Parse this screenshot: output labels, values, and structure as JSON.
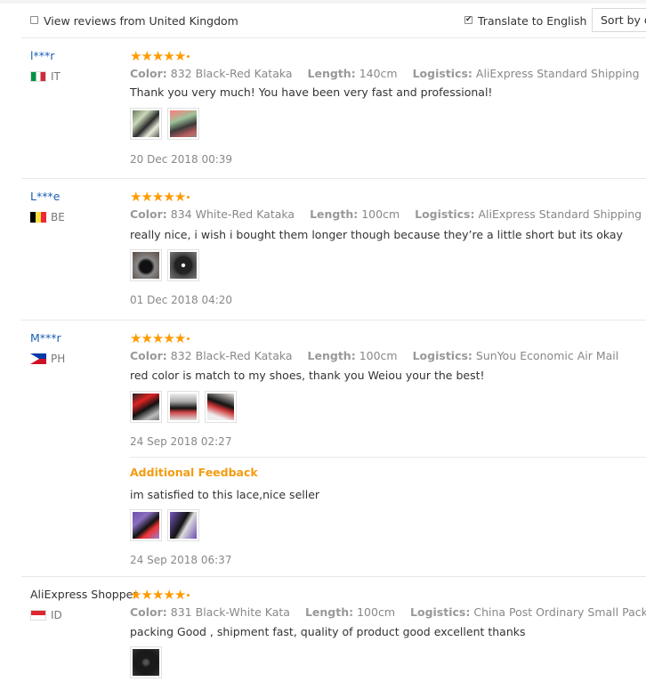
{
  "filters": {
    "view_local_label": "View reviews from United Kingdom",
    "view_local_checked": false,
    "translate_label": "Translate to English",
    "translate_checked": true,
    "sort_label": "Sort by de"
  },
  "labels": {
    "color": "Color:",
    "length": "Length:",
    "logistics": "Logistics:"
  },
  "reviews": [
    {
      "user": "l***r",
      "country_code": "IT",
      "flag": "italy-flag",
      "rating": 5,
      "color": "832 Black-Red Kataka",
      "length": "140cm",
      "logistics": "AliExpress Standard Shipping",
      "text": "Thank you very much! You have been very fast and professional!",
      "photos": [
        "shoe-photo",
        "shoe-photo"
      ],
      "date": "20 Dec 2018 00:39"
    },
    {
      "user": "L***e",
      "country_code": "BE",
      "flag": "belgium-flag",
      "rating": 5,
      "color": "834 White-Red Kataka",
      "length": "100cm",
      "logistics": "AliExpress Standard Shipping",
      "text": "really nice, i wish i bought them longer though because they’re a little short but its okay",
      "photos": [
        "shoe-photo",
        "shoe-photo"
      ],
      "date": "01 Dec 2018 04:20"
    },
    {
      "user": "M***r",
      "country_code": "PH",
      "flag": "philippines-flag",
      "rating": 5,
      "color": "832 Black-Red Kataka",
      "length": "100cm",
      "logistics": "SunYou Economic Air Mail",
      "text": "red color is match to my shoes, thank you Weiou your the best!",
      "photos": [
        "shoe-photo",
        "shoe-photo",
        "shoe-photo"
      ],
      "date": "24 Sep 2018 02:27",
      "additional": {
        "title": "Additional Feedback",
        "text": "im satisfied to this lace,nice seller",
        "photos": [
          "shoe-photo",
          "shoe-photo"
        ],
        "date": "24 Sep 2018 06:37"
      }
    },
    {
      "user": "AliExpress Shopper",
      "country_code": "ID",
      "flag": "indonesia-flag",
      "rating": 5,
      "color": "831 Black-White Kata",
      "length": "100cm",
      "logistics": "China Post Ordinary Small Packet Plus",
      "text": "packing Good , shipment fast, quality of product good excellent thanks",
      "photos": [
        "shoe-photo"
      ]
    }
  ]
}
